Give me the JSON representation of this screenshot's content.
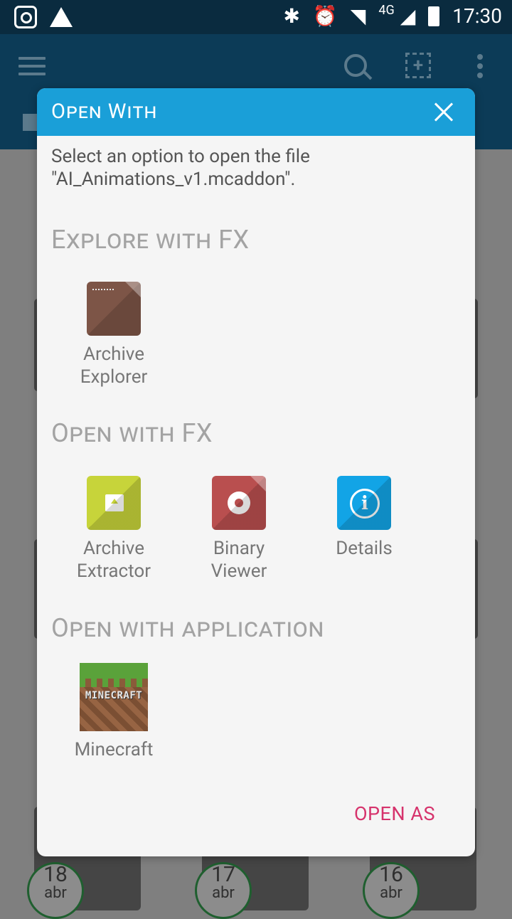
{
  "status_bar": {
    "net_type": "4G",
    "time": "17:30"
  },
  "dialog": {
    "title": "Open With",
    "message": "Select an option to open the file \"AI_Animations_v1.mcaddon\".",
    "sections": {
      "explore": {
        "title": "Explore with FX",
        "items": [
          {
            "line1": "Archive",
            "line2": "Explorer",
            "icon": "archive-icon"
          }
        ]
      },
      "open_fx": {
        "title": "Open with FX",
        "items": [
          {
            "line1": "Archive",
            "line2": "Extractor",
            "icon": "archive-extractor-icon"
          },
          {
            "line1": "Binary",
            "line2": "Viewer",
            "icon": "gear-icon"
          },
          {
            "line1": "Details",
            "line2": "",
            "icon": "info-icon"
          }
        ]
      },
      "open_app": {
        "title": "Open with application",
        "items": [
          {
            "line1": "Minecraft",
            "icon": "minecraft-icon",
            "logo_text": "MINECRAFT"
          }
        ]
      }
    },
    "action": "OPEN AS"
  },
  "background": {
    "dates": [
      {
        "day": "18",
        "month": "abr"
      },
      {
        "day": "17",
        "month": "abr"
      },
      {
        "day": "16",
        "month": "abr"
      }
    ]
  }
}
